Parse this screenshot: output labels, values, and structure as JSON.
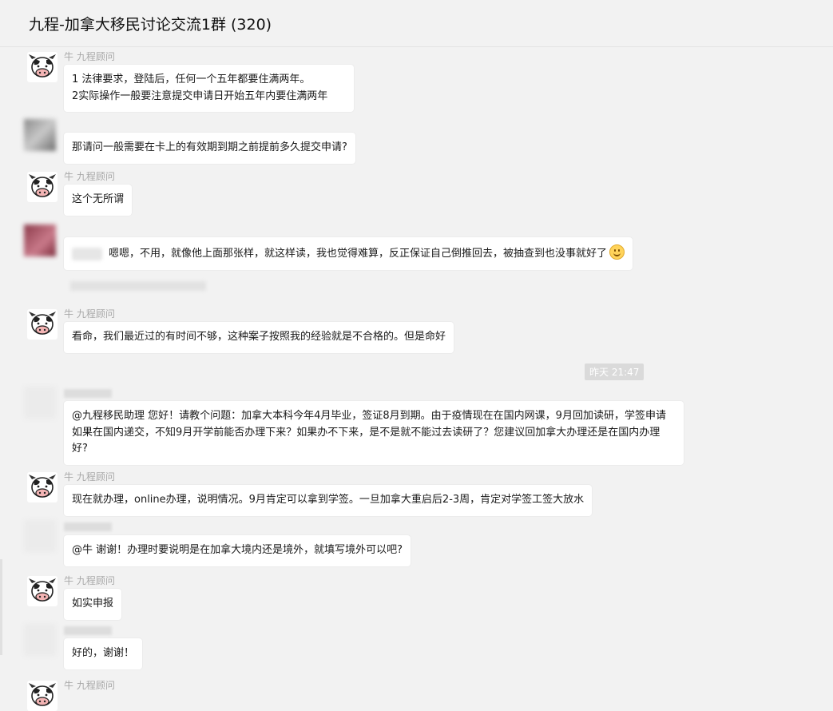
{
  "header": {
    "title": "九程-加拿大移民讨论交流1群 (320)"
  },
  "agent_name": "牛 九程顾问",
  "timestamp": "昨天 21:47",
  "messages": [
    {
      "text": "1 法律要求，登陆后，任何一个五年都要住满两年。\n2实际操作一般要注意提交申请日开始五年内要住满两年"
    },
    {
      "text": "那请问一般需要在卡上的有效期到期之前提前多久提交申请?"
    },
    {
      "text": "这个无所谓"
    },
    {
      "text": "嗯嗯，不用，就像他上面那张样，就这样读，我也觉得难算，反正保证自己倒推回去，被抽查到也没事就好了"
    },
    {
      "text": "看命，我们最近过的有时间不够，这种案子按照我的经验就是不合格的。但是命好"
    },
    {
      "text": "@九程移民助理 您好！请教个问题：加拿大本科今年4月毕业，签证8月到期。由于疫情现在在国内网课，9月回加读研，学签申请如果在国内递交，不知9月开学前能否办理下来？如果办不下来，是不是就不能过去读研了？您建议回加拿大办理还是在国内办理好?"
    },
    {
      "text": "现在就办理，online办理，说明情况。9月肯定可以拿到学签。一旦加拿大重启后2-3周，肯定对学签工签大放水"
    },
    {
      "text": "@牛 谢谢！办理时要说明是在加拿大境内还是境外，就填写境外可以吧?"
    },
    {
      "text": "如实申报"
    },
    {
      "text": "好的，谢谢！"
    }
  ],
  "colors": {
    "bg": "#f2f2f2",
    "bubble": "#ffffff",
    "sender": "#a8a8a8",
    "timestamp_bg": "#dadada"
  },
  "icons": {
    "agent_avatar": "cow-icon",
    "emoji": "smile-emoji-icon"
  }
}
